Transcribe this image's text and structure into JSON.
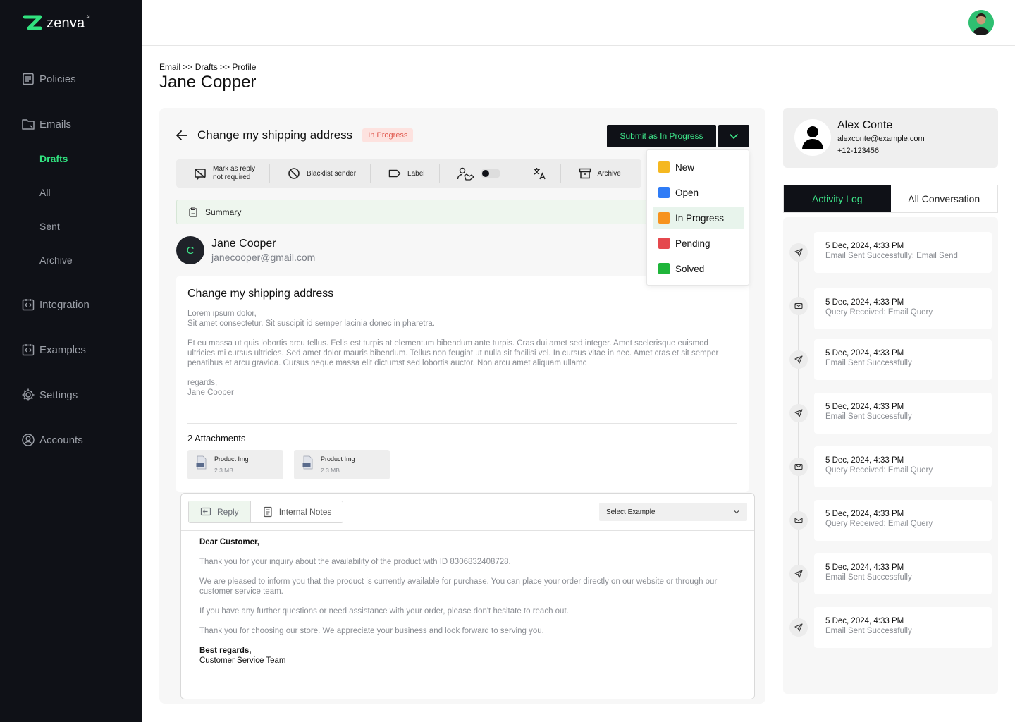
{
  "app": {
    "logo_text": "zenva",
    "logo_sup": "AI"
  },
  "sidebar": {
    "policies": "Policies",
    "emails": "Emails",
    "drafts": "Drafts",
    "all": "All",
    "sent": "Sent",
    "archive": "Archive",
    "integration": "Integration",
    "examples": "Examples",
    "settings": "Settings",
    "accounts": "Accounts"
  },
  "breadcrumb": "Email >> Drafts >> Profile",
  "page_title": "Jane Copper",
  "ticket": {
    "subject": "Change my shipping address",
    "status_badge": "In Progress",
    "submit_label": "Submit as In Progress"
  },
  "toolbar": {
    "mark_line1": "Mark as reply",
    "mark_line2": "not required",
    "blacklist": "Blacklist sender",
    "label": "Label",
    "archive": "Archive"
  },
  "summary_label": "Summary",
  "sender": {
    "initial": "C",
    "name": "Jane Cooper",
    "email": "janecooper@gmail.com"
  },
  "email": {
    "subject": "Change my shipping address",
    "body_p1_l1": "Lorem ipsum dolor,",
    "body_p1_l2": "Sit amet consectetur. Sit suscipit id semper lacinia donec in pharetra.",
    "body_p2": " Et eu massa ut quis lobortis arcu tellus. Felis est turpis at elementum bibendum ante turpis. Cras dui amet sed integer. Amet scelerisque euismod ultricies mi cursus ultricies. Sed amet dolor mauris bibendum. Tellus non feugiat ut nulla sit facilisi vel. In cursus vitae in nec. Amet cras et sit semper penatibus et arcu gravida. Cursus neque massa elit dictumst sed lobortis auctor. Non arcu amet aliquam ullamc",
    "sign_l1": "regards,",
    "sign_l2": "Jane Cooper",
    "attachments_title": "2 Attachments",
    "attachments": [
      {
        "name": "Product Img",
        "size": "2.3 MB",
        "tag": "IMG"
      },
      {
        "name": "Product Img",
        "size": "2.3 MB",
        "tag": "IMG"
      }
    ]
  },
  "composer": {
    "tab_reply": "Reply",
    "tab_notes": "Internal Notes",
    "select_placeholder": "Select Example",
    "greeting": "Dear Customer,",
    "p1": "Thank you for your inquiry about the availability of the product with ID 8306832408728.",
    "p2": "We are pleased to inform you that the product is currently available for purchase. You can place your order directly on our website or through our customer service team.",
    "p3": "If you have any further questions or need assistance with your order, please don't hesitate to reach out.",
    "p4": "Thank you for choosing our store. We appreciate your business and look forward to serving you.",
    "closing": "Best regards,",
    "team": "Customer Service Team"
  },
  "status_dropdown": [
    {
      "label": "New",
      "color": "#f5b820"
    },
    {
      "label": "Open",
      "color": "#2f7cf6"
    },
    {
      "label": "In Progress",
      "color": "#f7931e",
      "selected": true
    },
    {
      "label": "Pending",
      "color": "#e5484d"
    },
    {
      "label": "Solved",
      "color": "#1fb53a"
    }
  ],
  "contact": {
    "name": "Alex Conte",
    "email": "alexconte@example.com",
    "phone": "+12-123456"
  },
  "right_tabs": {
    "activity": "Activity Log",
    "conversation": "All Conversation"
  },
  "activity_log": [
    {
      "time": "5 Dec, 2024, 4:33 PM",
      "desc": "Email Sent Successfully: Email Send",
      "icon": "send-icon"
    },
    {
      "time": "5 Dec, 2024, 4:33 PM",
      "desc": "Query Received: Email Query",
      "icon": "mail-icon"
    },
    {
      "time": "5 Dec, 2024, 4:33 PM",
      "desc": "Email Sent Successfully",
      "icon": "send-icon"
    },
    {
      "time": "5 Dec, 2024, 4:33 PM",
      "desc": "Email Sent Successfully",
      "icon": "send-icon"
    },
    {
      "time": "5 Dec, 2024, 4:33 PM",
      "desc": "Query Received: Email Query",
      "icon": "mail-icon"
    },
    {
      "time": "5 Dec, 2024, 4:33 PM",
      "desc": "Query Received: Email Query",
      "icon": "mail-icon"
    },
    {
      "time": "5 Dec, 2024, 4:33 PM",
      "desc": "Email Sent Successfully",
      "icon": "send-icon"
    },
    {
      "time": "5 Dec, 2024, 4:33 PM",
      "desc": "Email Sent Successfully",
      "icon": "send-icon"
    }
  ],
  "colors": {
    "sidebar_bg": "#0f1117",
    "accent_green": "#3ee68a",
    "badge_red": "#e05a50"
  }
}
